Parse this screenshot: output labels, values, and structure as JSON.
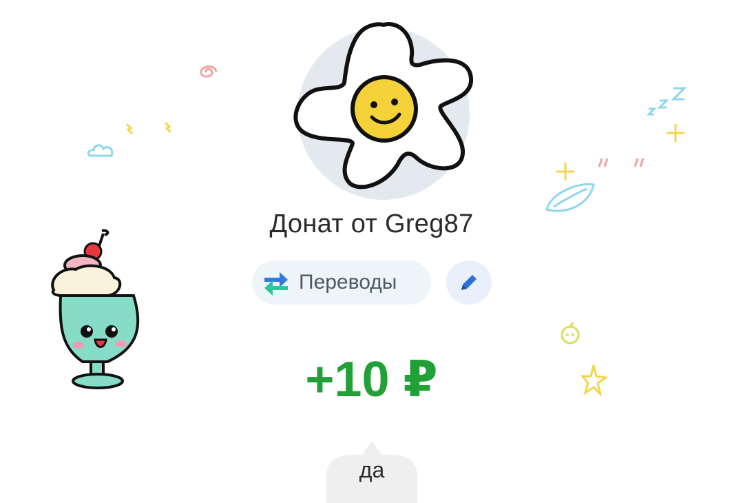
{
  "donation": {
    "title": "Донат от Greg87",
    "category_label": "Переводы",
    "amount": "+10 ₽",
    "comment": "да"
  },
  "icons": {
    "avatar": "flower-smiley-avatar",
    "category": "transfer-arrows-icon",
    "edit": "pencil-icon"
  },
  "colors": {
    "amount": "#21a038",
    "category_pill_bg": "#eef5f8",
    "edit_button_bg": "#e9f0fb",
    "edit_icon": "#2f6fd8",
    "transfer_icon_blue": "#2f7be0",
    "transfer_icon_teal": "#2ec4a0"
  }
}
